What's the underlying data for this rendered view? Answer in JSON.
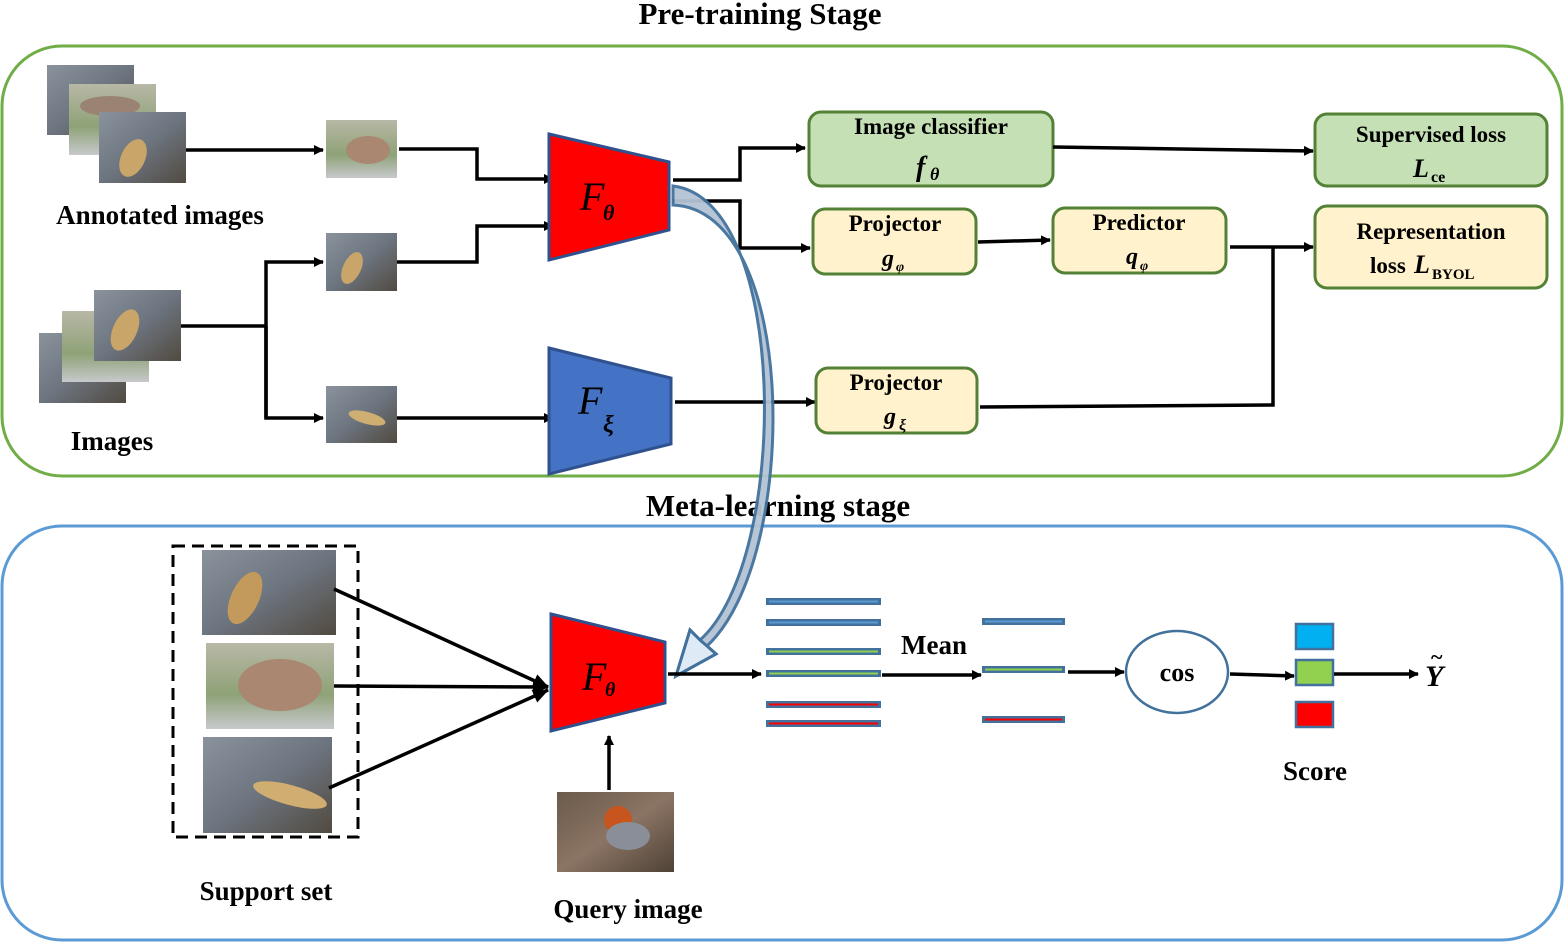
{
  "stages": {
    "pretraining": {
      "title": "Pre-training Stage",
      "border_color": "#70ad47"
    },
    "meta": {
      "title": "Meta-learning stage",
      "border_color": "#5b9bd5"
    }
  },
  "pretraining": {
    "annotated_images_label": "Annotated images",
    "images_label": "Images",
    "encoder_online": {
      "symbol": "F",
      "subscript": "θ",
      "color": "#ff0000"
    },
    "encoder_target": {
      "symbol": "F",
      "subscript": "ξ",
      "color": "#4472c4"
    },
    "image_classifier": {
      "title": "Image classifier",
      "symbol": "f",
      "subscript": "θ",
      "color": "#c5e0b4"
    },
    "projector_online": {
      "title": "Projector",
      "symbol": "g",
      "subscript": "φ",
      "color": "#fff2cc"
    },
    "predictor": {
      "title": "Predictor",
      "symbol": "q",
      "subscript": "φ",
      "color": "#fff2cc"
    },
    "projector_target": {
      "title": "Projector",
      "symbol": "g",
      "subscript": "ξ",
      "color": "#fff2cc"
    },
    "supervised_loss": {
      "title": "Supervised loss",
      "symbol": "L",
      "subscript": "ce",
      "color": "#c5e0b4"
    },
    "representation_loss": {
      "title": "Representation",
      "prefix": "loss ",
      "symbol": "L",
      "subscript": "BYOL",
      "color": "#fff2cc"
    }
  },
  "meta": {
    "support_set_label": "Support set",
    "query_image_label": "Query image",
    "encoder": {
      "symbol": "F",
      "subscript": "θ",
      "color": "#ff0000"
    },
    "mean_label": "Mean",
    "cos_label": "cos",
    "score_label": "Score",
    "output_symbol": "Y",
    "output_accent": "~",
    "score_colors": [
      "#00b0f0",
      "#92d050",
      "#ff0000"
    ],
    "feature_colors": [
      "#5b9bd5",
      "#5b9bd5",
      "#92d050",
      "#92d050",
      "#ff0000",
      "#ff0000"
    ],
    "prototype_colors": [
      "#5b9bd5",
      "#92d050",
      "#ff0000"
    ]
  }
}
